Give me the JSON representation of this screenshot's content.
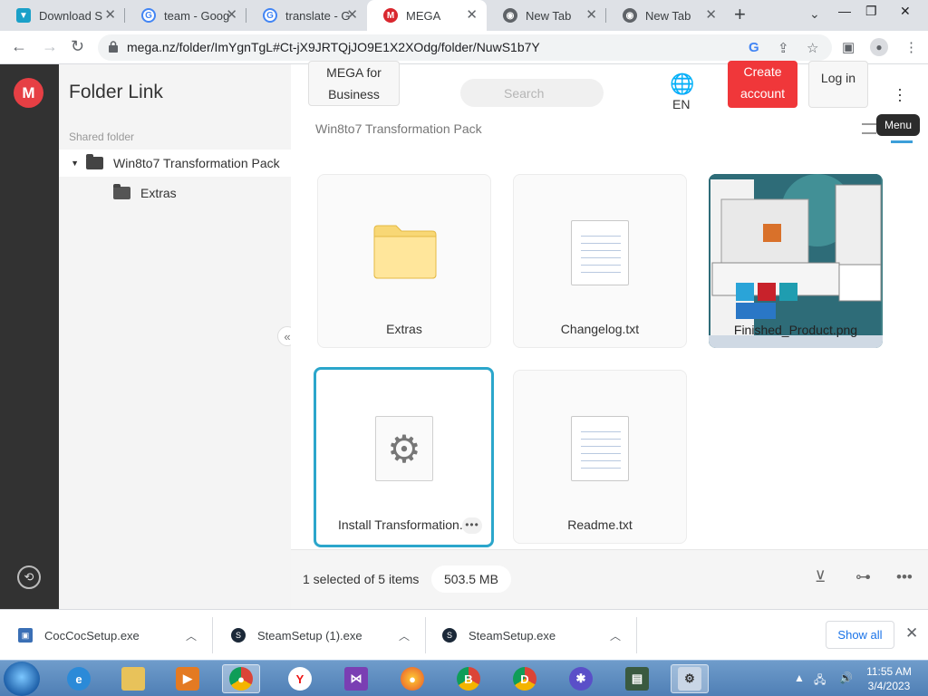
{
  "browser": {
    "tabs": [
      {
        "title": "Download S",
        "favicon": "download-site-icon",
        "color": "#1aa0c8"
      },
      {
        "title": "team - Goog",
        "favicon": "google-icon",
        "color": "#4285f4"
      },
      {
        "title": "translate - G",
        "favicon": "google-icon",
        "color": "#4285f4"
      },
      {
        "title": "MEGA",
        "favicon": "mega-icon",
        "color": "#d9272e",
        "active": true
      },
      {
        "title": "New Tab",
        "favicon": "chrome-icon",
        "color": "#5f6368"
      },
      {
        "title": "New Tab",
        "favicon": "chrome-icon",
        "color": "#5f6368"
      }
    ],
    "url": "mega.nz/folder/ImYgnTgL#Ct-jX9JRTQjJO9E1X2XOdg/folder/NuwS1b7Y"
  },
  "sidebar": {
    "title": "Folder Link",
    "shared_label": "Shared folder",
    "tree": [
      {
        "label": "Win8to7 Transformation Pack",
        "expanded": true
      },
      {
        "label": "Extras"
      }
    ]
  },
  "header": {
    "business_label": "MEGA for Business",
    "search_placeholder": "Search",
    "lang": "EN",
    "create_label": "Create account",
    "login_label": "Log in",
    "menu_tooltip": "Menu"
  },
  "breadcrumb": "Win8to7 Transformation Pack",
  "files": [
    {
      "name": "Extras",
      "kind": "folder"
    },
    {
      "name": "Changelog.txt",
      "kind": "text"
    },
    {
      "name": "Finished_Product.png",
      "kind": "image"
    },
    {
      "name": "Install Transformation.",
      "kind": "exe",
      "selected": true
    },
    {
      "name": "Readme.txt",
      "kind": "text"
    }
  ],
  "status": {
    "selection": "1 selected of 5 items",
    "size": "503.5 MB"
  },
  "downloads": [
    {
      "name": "CocCocSetup.exe",
      "icon": "coccoc-installer-icon"
    },
    {
      "name": "SteamSetup (1).exe",
      "icon": "steam-icon"
    },
    {
      "name": "SteamSetup.exe",
      "icon": "steam-icon"
    }
  ],
  "downloads_show_all": "Show all",
  "taskbar": {
    "time": "11:55 AM",
    "date": "3/4/2023"
  },
  "colors": {
    "mega_red": "#d9272e",
    "create_red": "#f0373a",
    "selected_border": "#2ba6cb",
    "rail": "#323232"
  }
}
